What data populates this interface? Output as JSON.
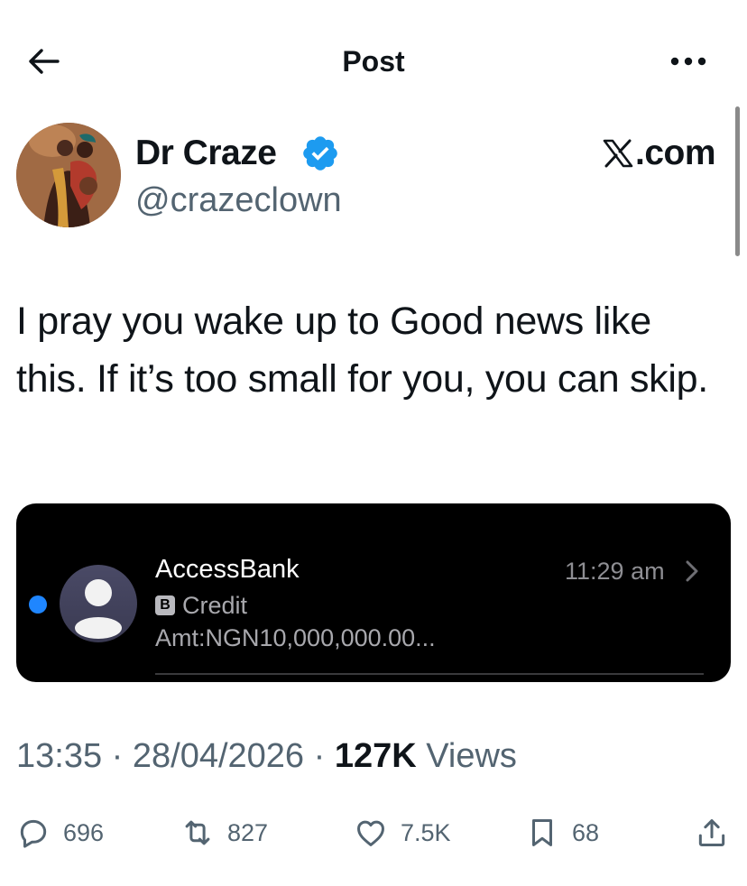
{
  "header": {
    "title": "Post"
  },
  "author": {
    "display_name": "Dr Craze",
    "handle": "@crazeclown",
    "source": ".com",
    "verified": true
  },
  "post": {
    "text": "I pray you wake up to Good news like this. If it’s too small for you, you can skip."
  },
  "media": {
    "sender": "AccessBank",
    "time": "11:29 am",
    "badge": "B",
    "subject": "Credit",
    "preview": "Amt:NGN10,000,000.00..."
  },
  "meta": {
    "time": "13:35",
    "date": "28/04/2026",
    "views_count": "127K",
    "views_label": "Views"
  },
  "actions": {
    "replies": "696",
    "reposts": "827",
    "likes": "7.5K",
    "bookmarks": "68"
  },
  "colors": {
    "verified": "#1d9bf0",
    "unread_dot": "#1f86ff",
    "secondary_text": "#536471"
  }
}
